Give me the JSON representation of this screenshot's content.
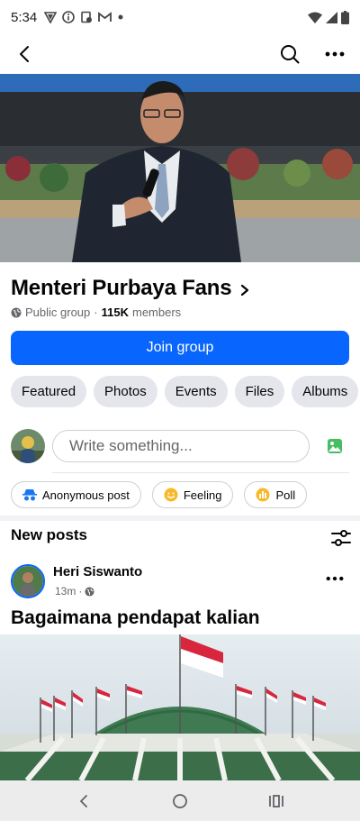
{
  "status_bar": {
    "time": "5:34",
    "left_icons": [
      "vpn-icon",
      "info-icon",
      "clipboard-icon",
      "gmail-icon",
      "dot-icon"
    ],
    "right_icons": [
      "wifi-icon",
      "signal-icon",
      "battery-icon"
    ]
  },
  "app_bar": {
    "icons": [
      "back-icon",
      "search-icon",
      "more-icon"
    ]
  },
  "group": {
    "title": "Menteri Purbaya Fans",
    "privacy": "Public group",
    "separator": "·",
    "member_count": "115K",
    "members_label": "members",
    "join_label": "Join group"
  },
  "tabs": [
    "Featured",
    "Photos",
    "Events",
    "Files",
    "Albums"
  ],
  "composer": {
    "placeholder": "Write something..."
  },
  "actions": [
    {
      "label": "Anonymous post",
      "icon": "anonymous-icon",
      "color": "#1877f2"
    },
    {
      "label": "Feeling",
      "icon": "feeling-icon",
      "color": "#f7b928"
    },
    {
      "label": "Poll",
      "icon": "poll-icon",
      "color": "#f7b928"
    }
  ],
  "feed": {
    "heading": "New posts"
  },
  "post": {
    "author": "Heri Siswanto",
    "time": "13m",
    "separator": "·",
    "text": "Bagaimana pendapat kalian"
  },
  "nav": {
    "icons": [
      "nav-back-icon",
      "home-icon",
      "recents-icon"
    ]
  },
  "colors": {
    "accent": "#0866ff",
    "chip_bg": "#e4e6eb",
    "secondary_text": "#65676b"
  }
}
